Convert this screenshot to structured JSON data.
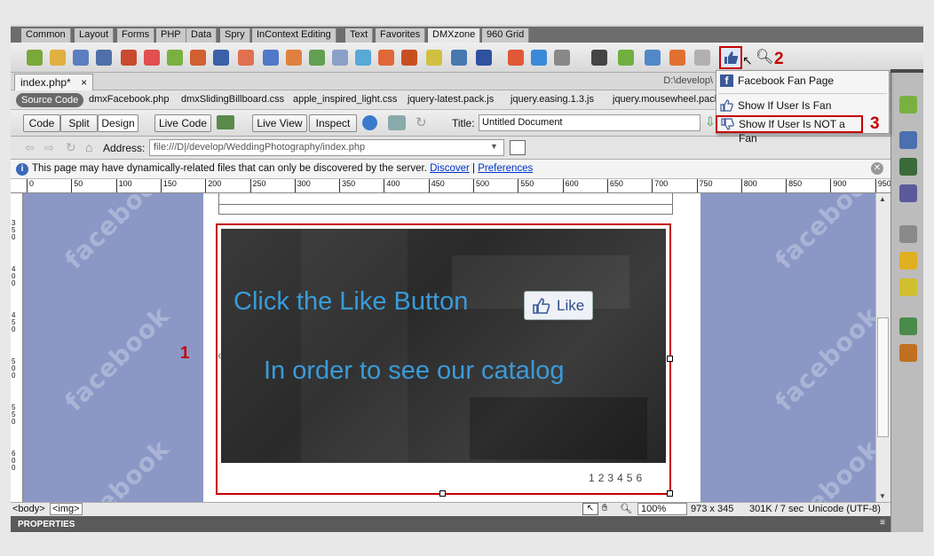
{
  "insert_tabs": [
    "Common",
    "Layout",
    "Forms",
    "PHP",
    "Data",
    "Spry",
    "InContext Editing",
    "Text",
    "Favorites",
    "DMXzone",
    "960 Grid"
  ],
  "active_tab": "DMXzone",
  "document_tab": {
    "name": "index.php*",
    "close": "×",
    "path": "D:\\develop\\"
  },
  "source_code_label": "Source Code",
  "related_files": [
    "dmxFacebook.php",
    "dmxSlidingBillboard.css",
    "apple_inspired_light.css",
    "jquery-latest.pack.js",
    "jquery.easing.1.3.js",
    "jquery.mousewheel.pack"
  ],
  "view_buttons": {
    "code": "Code",
    "split": "Split",
    "design": "Design",
    "live_code": "Live Code",
    "live_view": "Live View",
    "inspect": "Inspect"
  },
  "title_label": "Title:",
  "title_value": "Untitled Document",
  "address_label": "Address:",
  "address_value": "file:///D|/develop/WeddingPhotography/index.php",
  "info_bar": {
    "text": "This page may have dynamically-related files that can only be discovered by the server.",
    "discover": "Discover",
    "separator": "|",
    "preferences": "Preferences"
  },
  "ruler_marks": [
    "0",
    "50",
    "100",
    "150",
    "200",
    "250",
    "300",
    "350",
    "400",
    "450",
    "500",
    "550",
    "600",
    "650",
    "700",
    "750",
    "800",
    "850",
    "900",
    "950"
  ],
  "vruler_marks": [
    "350",
    "400",
    "450",
    "500",
    "550",
    "600"
  ],
  "watermark": "facebook",
  "banner": {
    "line1": "Click the Like Button",
    "line2": "In order to see our catalog",
    "like_label": "Like",
    "pager": [
      "1",
      "2",
      "3",
      "4",
      "5",
      "6"
    ]
  },
  "menu": {
    "header": "Facebook Fan Page",
    "items": [
      "Show If User Is Fan",
      "Show If User Is NOT a Fan"
    ]
  },
  "callouts": [
    "1",
    "2",
    "3"
  ],
  "status": {
    "tags": [
      "<body>",
      "<img>"
    ],
    "zoom": "100%",
    "dimensions": "973 x 345",
    "size": "301K / 7 sec",
    "encoding": "Unicode (UTF-8)"
  },
  "properties_label": "PROPERTIES",
  "colors": {
    "canvas": "#8b98c6",
    "callout": "#c40000",
    "link": "#0033cc",
    "banner_text": "#3a9bd8"
  }
}
